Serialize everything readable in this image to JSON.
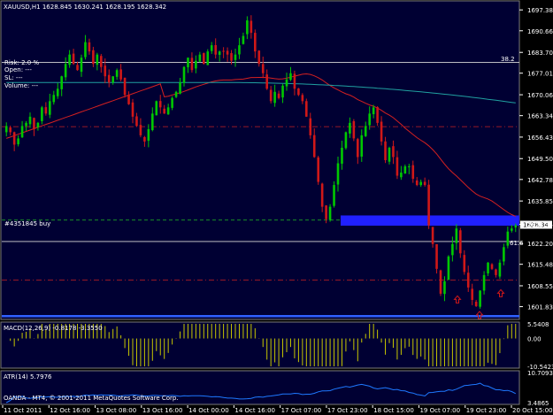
{
  "header": {
    "symbol_tf": "XAUUSD,H1",
    "ohlc": "1628.845 1630.241 1628.195 1628.342"
  },
  "trade_info": {
    "risk": "Risk:  2.0 %",
    "open": "Open:   ---",
    "sl": "SL:       ---",
    "volume": "Volume:   ---"
  },
  "order_label": "#4351845 buy",
  "annotations": {
    "level_382": "38.2",
    "level_618": "61.6"
  },
  "price_axis": {
    "labels": [
      "1697.38",
      "1690.66",
      "1683.70",
      "1677.01",
      "1670.06",
      "1663.34",
      "1656.43",
      "1649.50",
      "1642.78",
      "1635.85",
      "1628.34",
      "1622.20",
      "1615.48",
      "1608.55",
      "1601.83"
    ],
    "current_price": "1628.34",
    "range": [
      1598,
      1700
    ]
  },
  "time_axis": {
    "labels": [
      "11 Oct 2011",
      "12 Oct 16:00",
      "13 Oct 08:00",
      "13 Oct 16:00",
      "14 Oct 00:00",
      "14 Oct 16:00",
      "17 Oct 07:00",
      "17 Oct 23:00",
      "18 Oct 15:00",
      "19 Oct 07:00",
      "19 Oct 23:00",
      "20 Oct 15:00"
    ]
  },
  "macd": {
    "title": "MACD(12,26,9) -0.8178 -3.3550",
    "axis_labels": [
      "5.5408",
      "0.00",
      "-10.5423"
    ],
    "range": [
      -10.5423,
      5.5408
    ]
  },
  "atr": {
    "title": "ATR(14) 5.7976",
    "axis_labels": [
      "10.7093",
      "3.4865"
    ],
    "range": [
      3.4865,
      10.7093
    ]
  },
  "copyright": "OANDA - MT4, © 2001-2011 MetaQuotes Software Corp.",
  "colors": {
    "background": "#000000",
    "panel_bg": "#000033",
    "bull": "#00c800",
    "bear": "#d01818",
    "ma_fast": "#d42020",
    "ma_slow": "#20a0a0",
    "order_zone": "#2020ff",
    "dashed_level": "#c82020",
    "macd_bars": "#c8c800",
    "atr_line": "#1e78ff",
    "arrow": "#d01818"
  },
  "chart_data": {
    "type": "candlestick",
    "closes": [
      1660,
      1658,
      1654,
      1656,
      1660,
      1661,
      1663,
      1659,
      1661,
      1666,
      1664,
      1668,
      1670,
      1672,
      1676,
      1680,
      1683,
      1680,
      1678,
      1682,
      1687,
      1684,
      1680,
      1683,
      1679,
      1676,
      1674,
      1676,
      1678,
      1675,
      1670,
      1667,
      1663,
      1660,
      1657,
      1655,
      1659,
      1664,
      1668,
      1666,
      1664,
      1666,
      1669,
      1671,
      1674,
      1679,
      1682,
      1678,
      1681,
      1683,
      1680,
      1684,
      1686,
      1683,
      1684,
      1684,
      1683,
      1681,
      1683,
      1686,
      1689,
      1694,
      1690,
      1684,
      1680,
      1677,
      1672,
      1668,
      1671,
      1669,
      1673,
      1675,
      1677,
      1672,
      1670,
      1668,
      1663,
      1657,
      1650,
      1642,
      1634,
      1630,
      1634,
      1641,
      1648,
      1653,
      1658,
      1661,
      1656,
      1650,
      1657,
      1660,
      1664,
      1666,
      1661,
      1655,
      1649,
      1653,
      1650,
      1644,
      1645,
      1647,
      1647,
      1643,
      1641,
      1642,
      1641,
      1628,
      1622,
      1614,
      1606,
      1610,
      1618,
      1622,
      1627,
      1619,
      1613,
      1608,
      1604,
      1602,
      1607,
      1612,
      1616,
      1614,
      1612,
      1616,
      1621,
      1626,
      1627,
      1628
    ]
  }
}
